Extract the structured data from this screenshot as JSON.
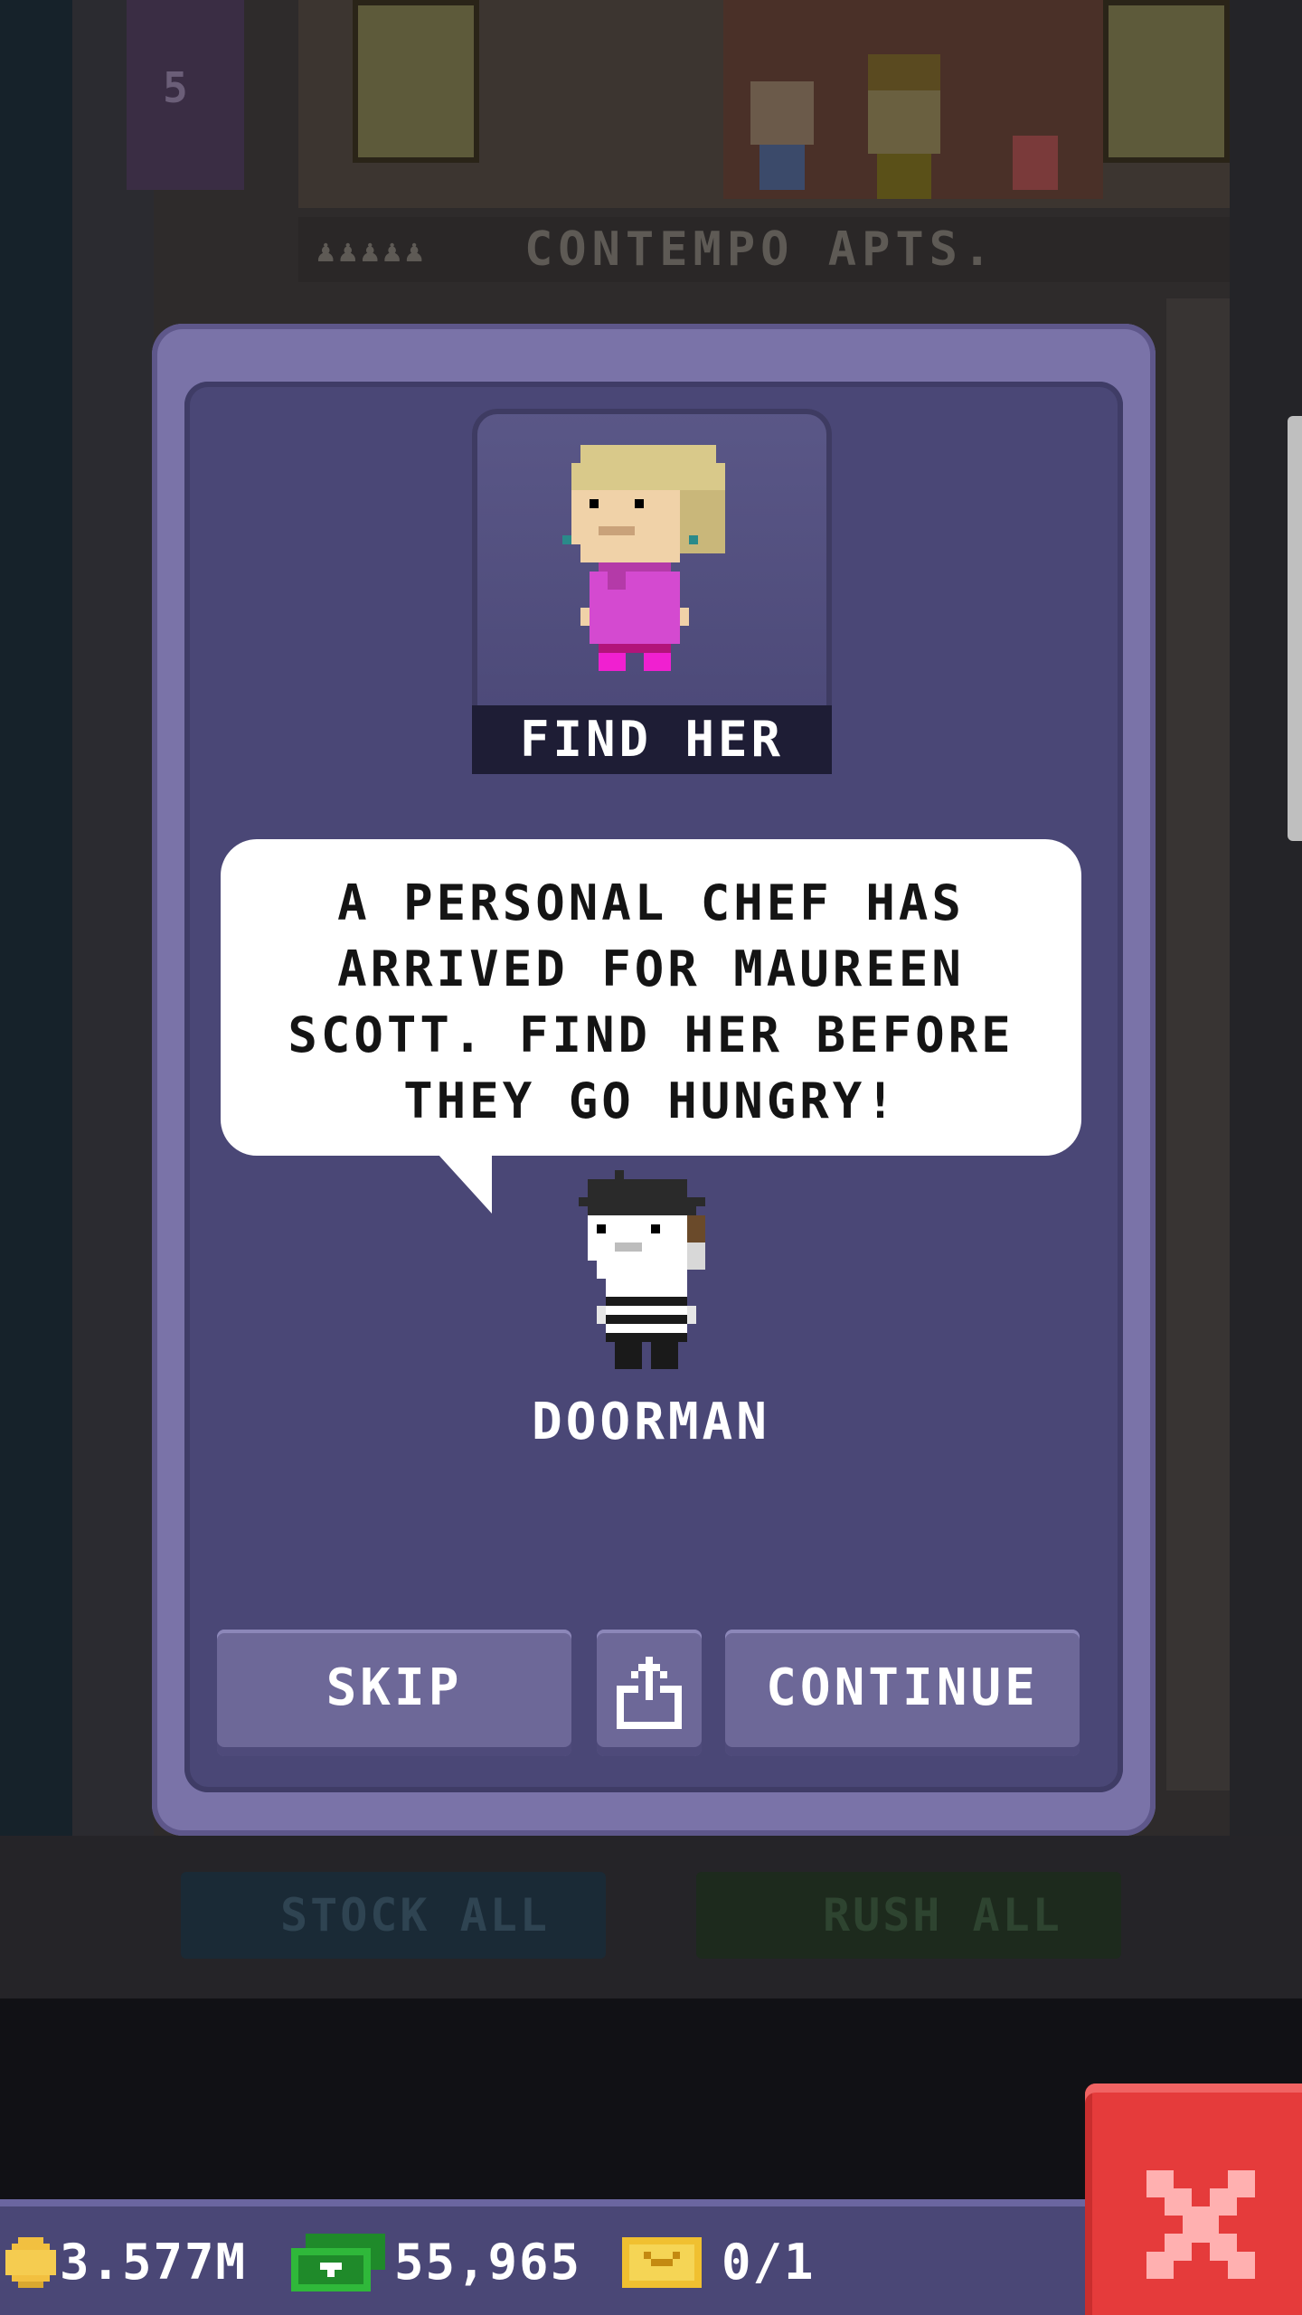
{
  "background": {
    "elevator_floor_number": "5",
    "floor_name": "CONTEMPO APTS.",
    "stock_all_label": "STOCK ALL",
    "rush_all_label": "RUSH ALL"
  },
  "dialog": {
    "portrait_label": "FIND HER",
    "message": "A PERSONAL CHEF HAS ARRIVED FOR MAUREEN SCOTT. FIND HER BEFORE THEY GO HUNGRY!",
    "speaker": "DOORMAN",
    "skip_label": "SKIP",
    "share_icon": "share-icon",
    "continue_label": "CONTINUE"
  },
  "currency": {
    "coins": "3.577M",
    "bux": "55,965",
    "tickets": "0/1"
  },
  "colors": {
    "panel": "#4a4776",
    "panel_border": "#7a73a8",
    "close_button": "#e53b3b"
  }
}
